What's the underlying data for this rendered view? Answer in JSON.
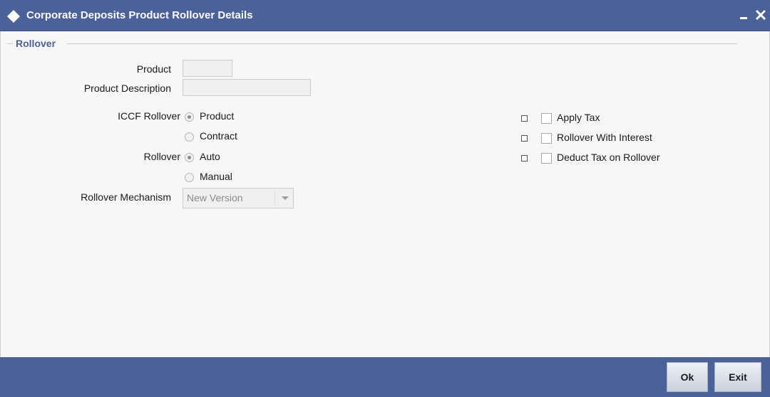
{
  "window": {
    "title": "Corporate Deposits Product Rollover Details",
    "minimize_icon": "minimize-icon",
    "close_icon": "close-icon",
    "title_icon": "diamond-icon"
  },
  "section": {
    "legend": "Rollover"
  },
  "fields": {
    "product_label": "Product",
    "product_value": "",
    "product_description_label": "Product Description",
    "product_description_value": "",
    "iccf_rollover_label": "ICCF Rollover",
    "iccf_rollover_options": [
      "Product",
      "Contract"
    ],
    "iccf_rollover_selected": "Product",
    "rollover_label": "Rollover",
    "rollover_options": [
      "Auto",
      "Manual"
    ],
    "rollover_selected": "Auto",
    "rollover_mechanism_label": "Rollover Mechanism",
    "rollover_mechanism_value": "New Version"
  },
  "checkboxes": [
    {
      "label": "Apply Tax",
      "checked": false
    },
    {
      "label": "Rollover With Interest",
      "checked": false
    },
    {
      "label": "Deduct Tax on Rollover",
      "checked": false
    }
  ],
  "footer": {
    "ok_label": "Ok",
    "exit_label": "Exit"
  },
  "colors": {
    "title_bar": "#4a6199",
    "legend_text": "#4a6199",
    "footer_bar": "#4a6199"
  }
}
